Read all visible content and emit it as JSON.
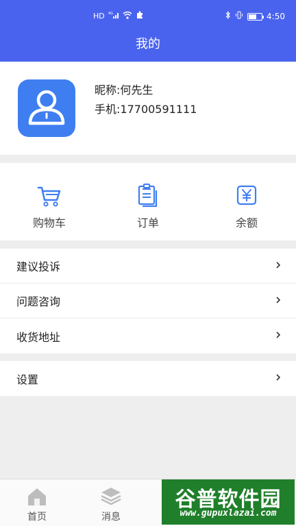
{
  "status_bar": {
    "left_icons": [
      "hd-icon",
      "signal-4g-icon",
      "wifi-icon",
      "puzzle-icon"
    ],
    "time": "4:50",
    "network_label": "HD",
    "network_gen": "4G",
    "battery_level": 0.6
  },
  "header": {
    "title": "我的"
  },
  "profile": {
    "nickname_label": "昵称:",
    "nickname": "何先生",
    "phone_label": "手机:",
    "phone": "17700591111"
  },
  "shortcuts": [
    {
      "label": "购物车",
      "icon": "cart-icon"
    },
    {
      "label": "订单",
      "icon": "order-icon"
    },
    {
      "label": "余额",
      "icon": "yuan-icon"
    }
  ],
  "menu_group1": [
    {
      "label": "建议投诉"
    },
    {
      "label": "问题咨询"
    },
    {
      "label": "收货地址"
    }
  ],
  "menu_group2": [
    {
      "label": "设置"
    }
  ],
  "tabbar": [
    {
      "label": "首页",
      "icon": "home-icon"
    },
    {
      "label": "消息",
      "icon": "layers-icon"
    }
  ],
  "watermark": {
    "title": "谷普软件园",
    "url": "www.gupuxlazai.com"
  },
  "colors": {
    "header": "#4a63ee",
    "accent_icon": "#3f7ef0"
  }
}
